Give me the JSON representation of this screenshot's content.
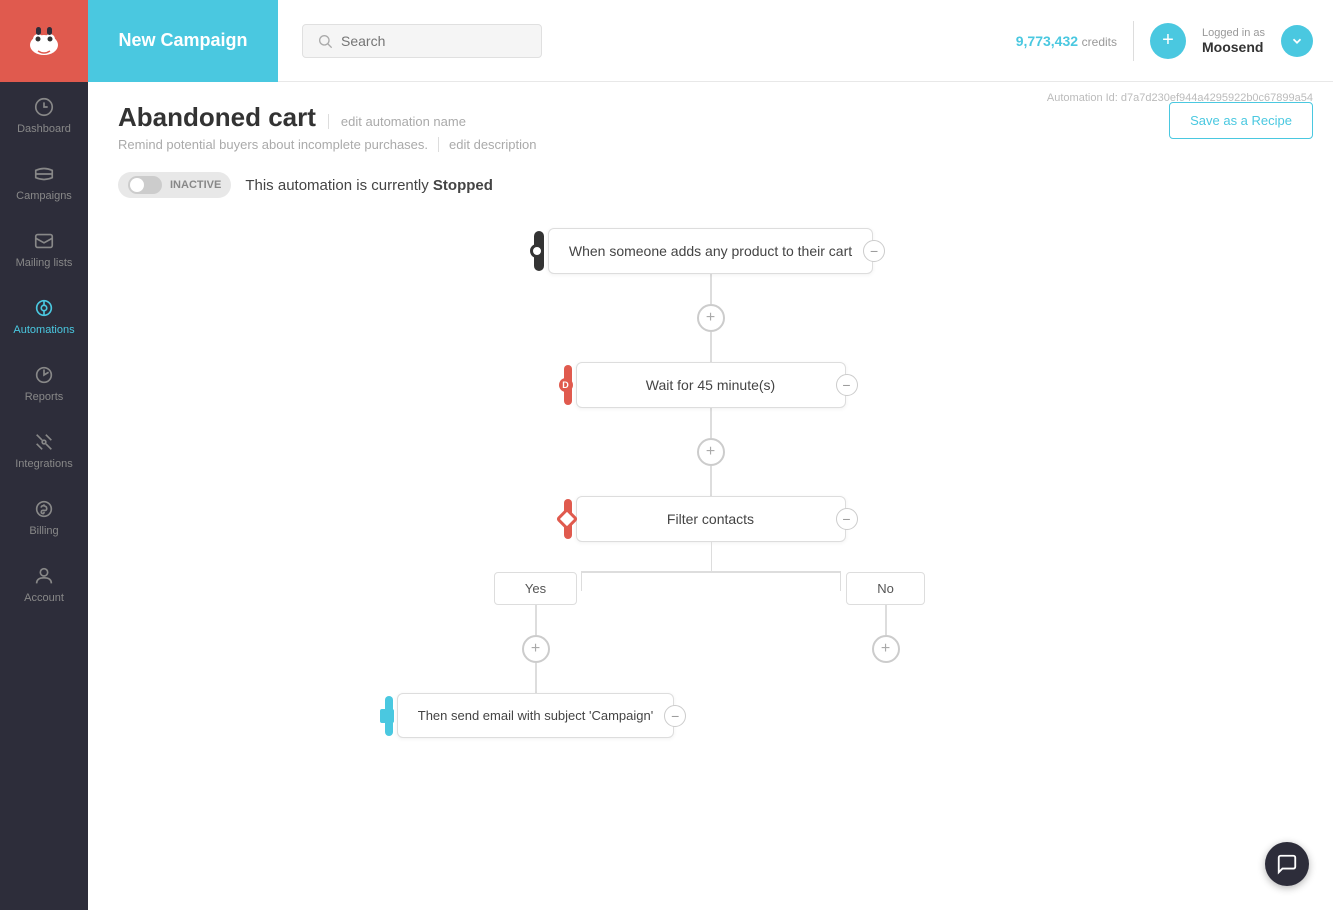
{
  "sidebar": {
    "items": [
      {
        "id": "dashboard",
        "label": "Dashboard",
        "active": false
      },
      {
        "id": "campaigns",
        "label": "Campaigns",
        "active": false
      },
      {
        "id": "mailing-lists",
        "label": "Mailing lists",
        "active": false
      },
      {
        "id": "automations",
        "label": "Automations",
        "active": true
      },
      {
        "id": "reports",
        "label": "Reports",
        "active": false
      },
      {
        "id": "integrations",
        "label": "Integrations",
        "active": false
      },
      {
        "id": "billing",
        "label": "Billing",
        "active": false
      },
      {
        "id": "account",
        "label": "Account",
        "active": false
      }
    ]
  },
  "header": {
    "title": "New Campaign",
    "search_placeholder": "Search",
    "credits": "9,773,432",
    "credits_label": "credits",
    "logged_in_label": "Logged in as",
    "logged_in_user": "Moosend"
  },
  "page": {
    "automation_id": "Automation Id: d7a7d230ef944a4295922b0c67899a54",
    "title": "Abandoned cart",
    "edit_name_link": "edit automation name",
    "description": "Remind potential buyers about incomplete purchases.",
    "edit_desc_link": "edit description",
    "save_recipe_label": "Save as a Recipe",
    "status_toggle": "INACTIVE",
    "status_text": "This automation is currently",
    "status_value": "Stopped"
  },
  "flow": {
    "node1_text": "When someone adds any product to their cart",
    "add1_label": "+",
    "node2_text": "Wait for 45 minute(s)",
    "add2_label": "+",
    "node3_text": "Filter contacts",
    "branch_yes": "Yes",
    "branch_no": "No",
    "node4_text": "Then send email with subject 'Campaign'",
    "minus_label": "−"
  },
  "chat": {
    "icon": "💬"
  }
}
